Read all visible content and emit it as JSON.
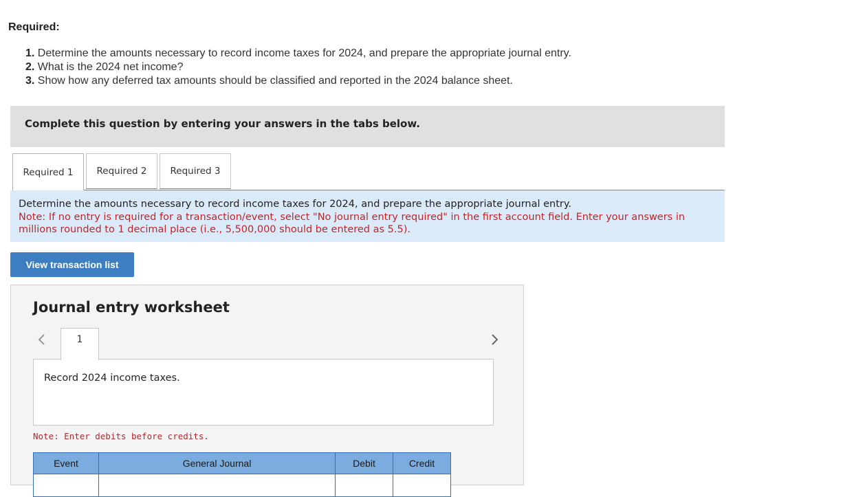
{
  "required": {
    "heading": "Required:",
    "items": [
      {
        "num": "1.",
        "text": " Determine the amounts necessary to record income taxes for 2024, and prepare the appropriate journal entry."
      },
      {
        "num": "2.",
        "text": " What is the 2024 net income?"
      },
      {
        "num": "3.",
        "text": " Show how any deferred tax amounts should be classified and reported in the 2024 balance sheet."
      }
    ]
  },
  "banner": {
    "text": "Complete this question by entering your answers in the tabs below."
  },
  "tabs": [
    {
      "label": "Required 1",
      "active": true
    },
    {
      "label": "Required 2",
      "active": false
    },
    {
      "label": "Required 3",
      "active": false
    }
  ],
  "instructions": {
    "text": "Determine the amounts necessary to record income taxes for 2024, and prepare the appropriate journal entry.",
    "note": "Note: If no entry is required for a transaction/event, select \"No journal entry required\" in the first account field. Enter your answers in millions rounded to 1 decimal place (i.e., 5,500,000 should be entered as 5.5)."
  },
  "view_button": {
    "label": "View transaction list"
  },
  "worksheet": {
    "title": "Journal entry worksheet",
    "current_page": "1",
    "prev_icon": "chevron-left-icon",
    "next_icon": "chevron-right-icon",
    "description": "Record 2024 income taxes.",
    "note": "Note: Enter debits before credits.",
    "columns": [
      "Event",
      "General Journal",
      "Debit",
      "Credit"
    ]
  },
  "colors": {
    "banner_bg": "#e0e0e0",
    "instructions_bg": "#dbeaf8",
    "note_red": "#c0252a",
    "button_blue": "#3d7ec2",
    "table_header": "#7aace0"
  }
}
